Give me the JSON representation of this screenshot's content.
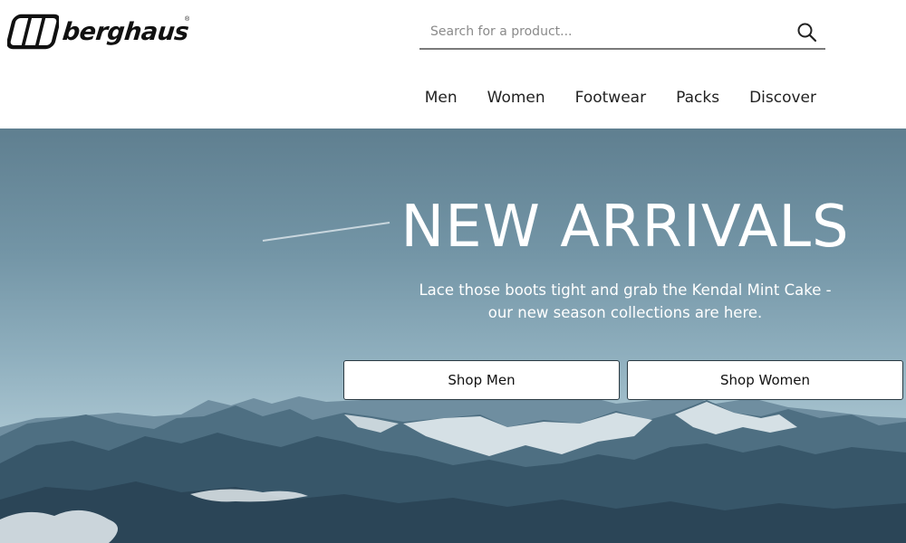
{
  "brand": {
    "name": "berghaus",
    "registered": "®"
  },
  "search": {
    "placeholder": "Search for a product...",
    "value": "",
    "icon": "search-icon"
  },
  "nav": {
    "items": [
      "Men",
      "Women",
      "Footwear",
      "Packs",
      "Discover"
    ]
  },
  "hero": {
    "title": "NEW ARRIVALS",
    "subtitle_line1": "Lace those boots tight and grab the Kendal Mint Cake -",
    "subtitle_line2": "our new season collections are here.",
    "cta_men": "Shop Men",
    "cta_women": "Shop Women"
  },
  "colors": {
    "header_bg": "#ffffff",
    "hero_sky": "#7395a6",
    "text_dark": "#222222",
    "button_bg": "#ffffff"
  }
}
